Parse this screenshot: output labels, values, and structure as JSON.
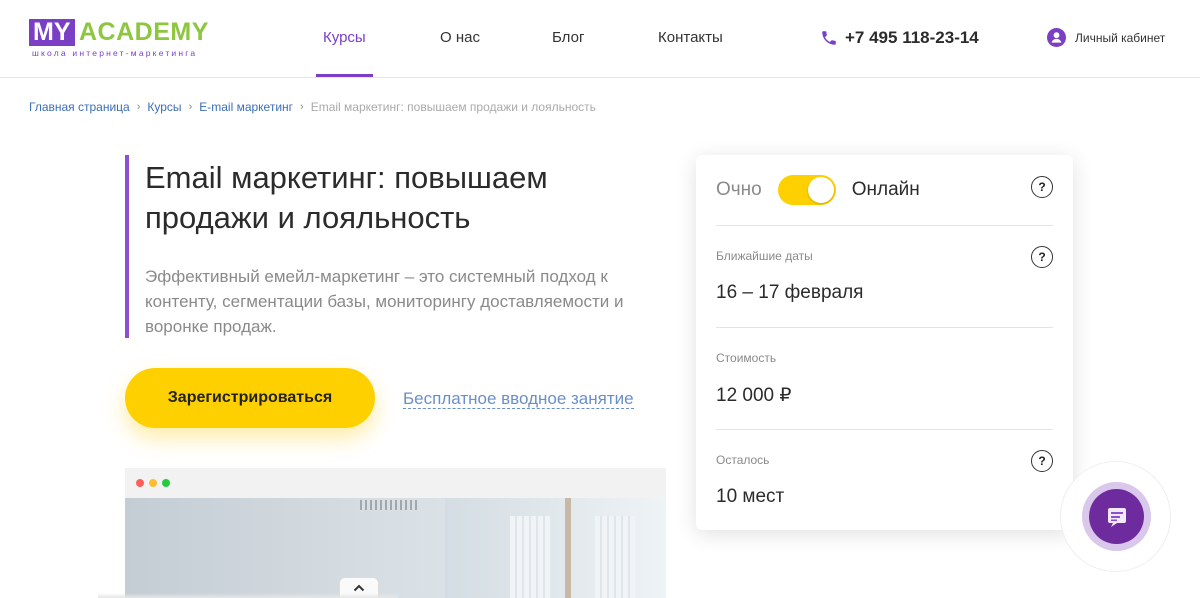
{
  "header": {
    "logo": {
      "my": "MY",
      "academy": "ACADEMY",
      "tagline": "школа интернет-маркетинга"
    },
    "nav": [
      {
        "label": "Курсы",
        "active": true
      },
      {
        "label": "О нас",
        "active": false
      },
      {
        "label": "Блог",
        "active": false
      },
      {
        "label": "Контакты",
        "active": false
      }
    ],
    "phone": "+7 495 118-23-14",
    "account_label": "Личный кабинет"
  },
  "breadcrumb": [
    "Главная страница",
    "Курсы",
    "E-mail маркетинг",
    "Email маркетинг: повышаем продажи и лояльность"
  ],
  "hero": {
    "title": "Email маркетинг: повышаем продажи и лояльность",
    "description": "Эффективный емейл-маркетинг – это системный подход к контенту, сегментации базы, мониторингу доставляемости и воронке продаж.",
    "register_button": "Зарегистрироваться",
    "free_lesson_link": "Бесплатное вводное занятие"
  },
  "card": {
    "mode_offline": "Очно",
    "mode_online": "Онлайн",
    "help_symbol": "?",
    "dates_label": "Ближайшие даты",
    "dates_value": "16 – 17 февраля",
    "price_label": "Стоимость",
    "price_value": "12 000 ₽",
    "seats_label": "Осталось",
    "seats_value": "10 мест"
  },
  "colors": {
    "brand_purple": "#7a3fc4",
    "brand_green": "#8dc63f",
    "accent_yellow": "#ffd000",
    "link_blue": "#3b6fb6"
  },
  "icons": {
    "phone": "phone-icon",
    "account": "user-icon",
    "chat": "chat-icon",
    "scroll_up": "chevron-up-icon"
  }
}
